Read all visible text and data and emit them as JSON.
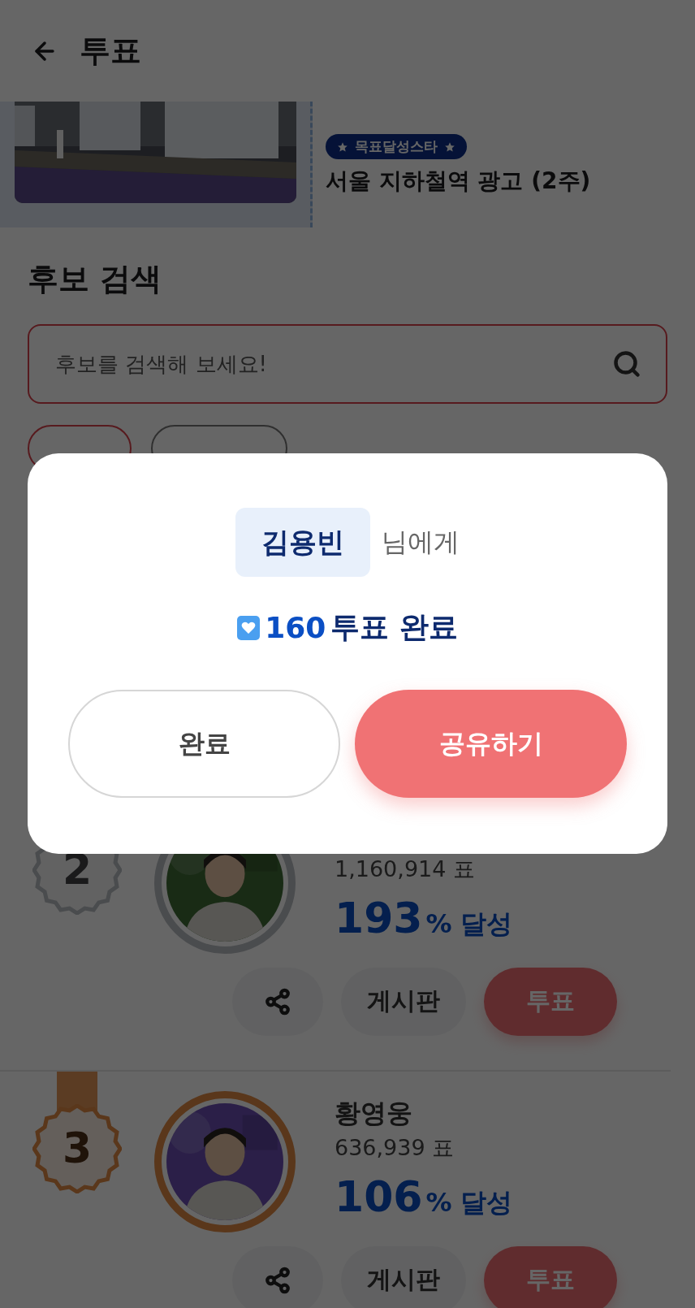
{
  "header": {
    "title": "투표"
  },
  "banner": {
    "badge": "목표달성스타",
    "title": "서울 지하철역 광고 (2주)"
  },
  "search_section": {
    "title": "후보 검색",
    "search": {
      "placeholder": "후보를 검색해 보세요!"
    },
    "filters": [
      {
        "selected": true
      },
      {
        "selected": false
      }
    ]
  },
  "candidates": [
    {
      "rank": "2",
      "kind": "silver",
      "votes": "1,160,914 표",
      "percent": "193",
      "percent_unit": "%",
      "achieve": "달성",
      "board": "게시판",
      "vote": "투표"
    },
    {
      "rank": "3",
      "kind": "bronze",
      "name": "황영웅",
      "votes": "636,939 표",
      "percent": "106",
      "percent_unit": "%",
      "achieve": "달성",
      "board": "게시판",
      "vote": "투표"
    }
  ],
  "dialog": {
    "name": "김용빈",
    "suffix": "님에게",
    "count": "160",
    "message": "투표 완료",
    "buttons": [
      {
        "label": "완료",
        "kind": "secondary"
      },
      {
        "label": "공유하기",
        "kind": "primary"
      }
    ]
  }
}
